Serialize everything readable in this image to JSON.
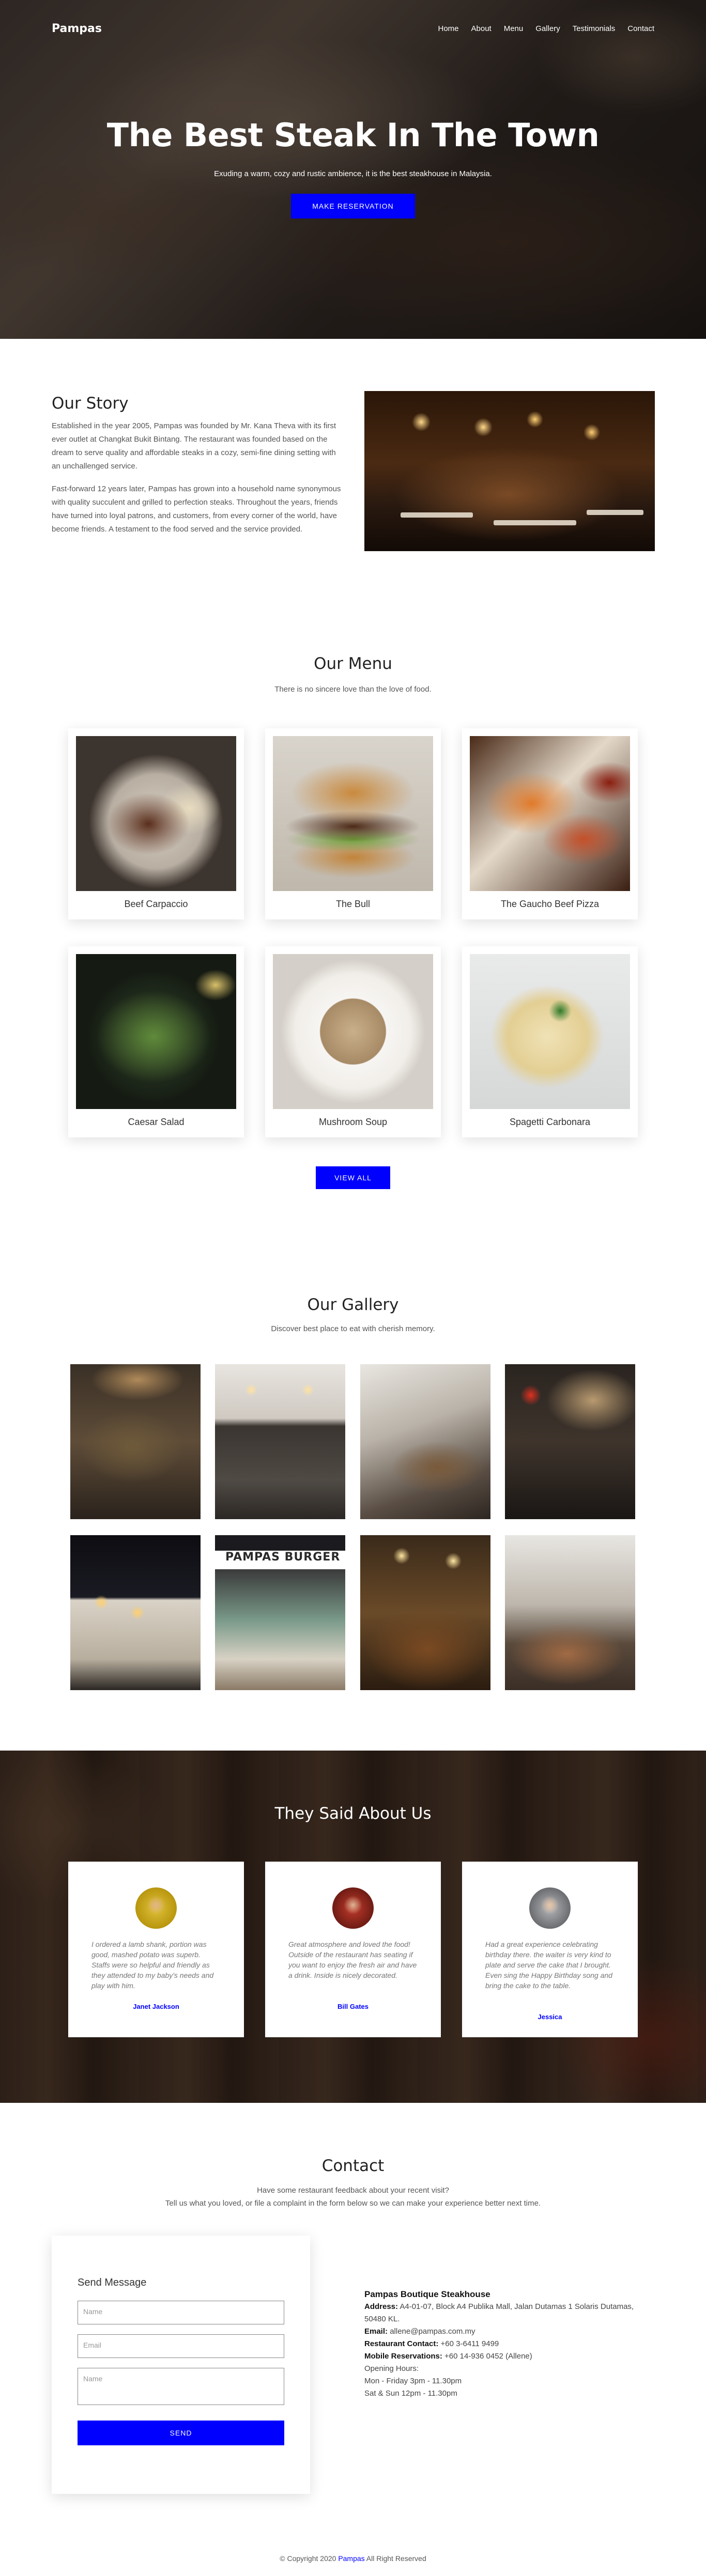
{
  "nav": {
    "brand": "Pampas",
    "links": [
      "Home",
      "About",
      "Menu",
      "Gallery",
      "Testimonials",
      "Contact"
    ]
  },
  "hero": {
    "title": "The Best Steak In The Town",
    "subtitle": "Exuding a warm, cozy and rustic ambience, it is the best steakhouse in Malaysia.",
    "button": "MAKE RESERVATION"
  },
  "story": {
    "title": "Our Story",
    "p1": "Established in the year 2005, Pampas was founded by Mr. Kana Theva with its first ever outlet at Changkat Bukit Bintang. The restaurant was founded based on the dream to serve quality and affordable steaks in a cozy, semi-fine dining setting with an unchallenged service.",
    "p2": "Fast-forward 12 years later, Pampas has grown into a household name synonymous with quality succulent and grilled to perfection steaks. Throughout the years, friends have turned into loyal patrons, and customers, from every corner of the world, have become friends. A testament to the food served and the service provided."
  },
  "menu": {
    "title": "Our Menu",
    "subtitle": "There is no sincere love than the love of food.",
    "items": [
      "Beef Carpaccio",
      "The Bull",
      "The Gaucho Beef Pizza",
      "Caesar Salad",
      "Mushroom Soup",
      "Spagetti Carbonara"
    ],
    "button": "VIEW ALL"
  },
  "gallery": {
    "title": "Our Gallery",
    "subtitle": "Discover best place to eat with cherish memory.",
    "sign_text": "PAMPAS BURGER"
  },
  "testimonials": {
    "title": "They Said About Us",
    "items": [
      {
        "text": "I ordered a lamb shank, portion was good, mashed potato was superb. Staffs were so helpful and friendly as they attended to my baby's needs and play with him.",
        "name": "Janet Jackson"
      },
      {
        "text": "Great atmosphere and loved the food! Outside of the restaurant has seating if you want to enjoy the fresh air and have a drink. Inside is nicely decorated.",
        "name": "Bill Gates"
      },
      {
        "text": "Had a great experience celebrating birthday there. the waiter is very kind to plate and serve the cake that I brought. Even sing the Happy Birthday song and bring the cake to the table.",
        "name": "Jessica"
      }
    ]
  },
  "contact": {
    "title": "Contact",
    "subtitle1": "Have some restaurant feedback about your recent visit?",
    "subtitle2": "Tell us what you loved, or file a complaint in the form below so we can make your experience better next time.",
    "form_title": "Send Message",
    "name_placeholder": "Name",
    "email_placeholder": "Email",
    "message_placeholder": "Name",
    "send_button": "SEND",
    "business": "Pampas Boutique Steakhouse",
    "address_label": "Address:",
    "address": "A4-01-07, Block A4 Publika Mall, Jalan Dutamas 1 Solaris Dutamas, 50480 KL.",
    "email_label": "Email:",
    "email": "allene@pampas.com.my",
    "phone_label": "Restaurant Contact:",
    "phone": "+60 3-6411 9499",
    "mobile_label": "Mobile Reservations:",
    "mobile": "+60 14-936 0452 (Allene)",
    "hours_title": "Opening Hours:",
    "hours1": "Mon - Friday 3pm - 11.30pm",
    "hours2": "Sat & Sun 12pm - 11.30pm"
  },
  "footer": {
    "prefix": "© Copyright 2020",
    "link": "Pampas",
    "suffix": "All Right Reserved"
  },
  "colors": {
    "accent": "#0000ff"
  }
}
